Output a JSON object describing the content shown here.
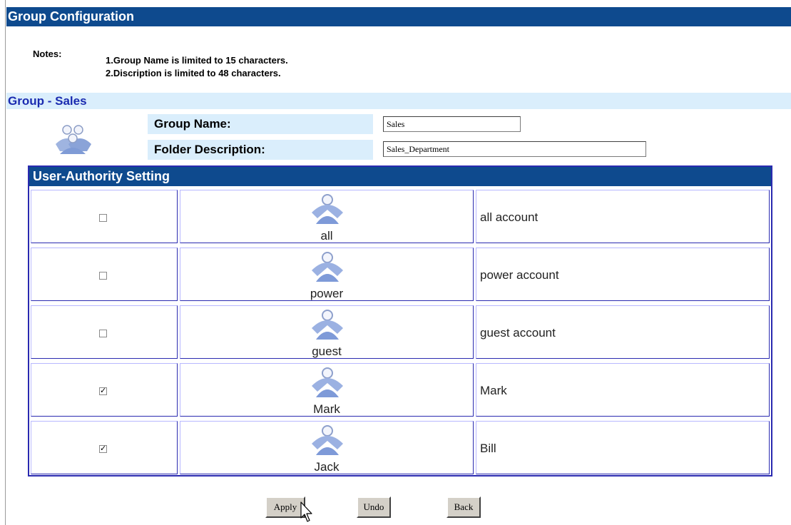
{
  "page": {
    "title": "Group Configuration"
  },
  "notes": {
    "label": "Notes:",
    "lines": [
      "1.Group Name is limited to 15 characters.",
      "2.Discription is limited to 48 characters."
    ]
  },
  "group": {
    "header": "Group - Sales",
    "icon": "group-icon",
    "name_label": "Group Name:",
    "name_value": "Sales",
    "description_label": "Folder Description:",
    "description_value": "Sales_Department"
  },
  "user_authority": {
    "header": "User-Authority Setting",
    "rows": [
      {
        "checked": false,
        "name": "all",
        "description": "all account",
        "icon": "user-icon"
      },
      {
        "checked": false,
        "name": "power",
        "description": "power account",
        "icon": "user-icon"
      },
      {
        "checked": false,
        "name": "guest",
        "description": "guest account",
        "icon": "user-icon"
      },
      {
        "checked": true,
        "name": "Mark",
        "description": "Mark",
        "icon": "user-icon"
      },
      {
        "checked": true,
        "name": "Jack",
        "description": "Bill",
        "icon": "user-icon"
      }
    ]
  },
  "buttons": {
    "apply": "Apply",
    "undo": "Undo",
    "back": "Back"
  },
  "colors": {
    "title_bar": "#0e4a8e",
    "light_header": "#daeefc",
    "group_header_text": "#1a2bb0",
    "table_border": "#2a2ab0"
  }
}
